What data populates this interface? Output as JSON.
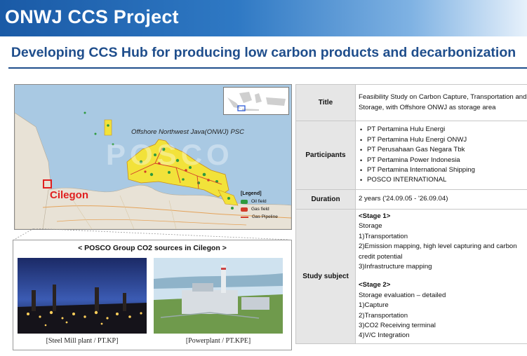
{
  "header": {
    "title": "ONWJ CCS Project",
    "subtitle": "Developing CCS Hub for producing low carbon products and decarbonization"
  },
  "map": {
    "psc_label": "Offshore Northwest Java(ONWJ) PSC",
    "city_label": "Cilegon",
    "watermark": "POSCO",
    "legend": {
      "title": "[Legend]",
      "items": [
        {
          "label": "Oil field",
          "color": "#2e9a3e"
        },
        {
          "label": "Gas field",
          "color": "#d23b2a"
        },
        {
          "label": "Gas Pipeline",
          "color": "#d23b2a"
        }
      ]
    },
    "colors": {
      "sea": "#a9c9e3",
      "land": "#e8e2d6",
      "block": "#f2e23a",
      "oil": "#2e9a3e",
      "pipeline": "#d23b2a"
    }
  },
  "sources": {
    "header": "< POSCO Group CO2 sources in Cilegon >",
    "captions": [
      "[Steel Mill plant / PT.KP]",
      "[Powerplant / PT.KPE]"
    ]
  },
  "table": {
    "title_key": "Title",
    "title_value": "Feasibility Study on Carbon Capture, Transportation and Storage, with Offshore ONWJ as storage area",
    "participants_key": "Participants",
    "participants": [
      "PT Pertamina Hulu Energi",
      "PT Pertamina Hulu Energi ONWJ",
      "PT Perusahaan Gas Negara Tbk",
      "PT Pertamina Power Indonesia",
      "PT Pertamina International Shipping",
      "POSCO INTERNATIONAL"
    ],
    "duration_key": "Duration",
    "duration_value": "2 years ('24.09.05 - '26.09.04)",
    "study_key": "Study subject",
    "stage1": {
      "title": "<Stage 1>",
      "lines": [
        "Storage",
        "1)Transportation",
        "2)Emission mapping, high level capturing and carbon credit potential",
        "3)Infrastructure mapping"
      ]
    },
    "stage2": {
      "title": "<Stage 2>",
      "lines": [
        "Storage evaluation – detailed",
        "1)Capture",
        "2)Transportation",
        "3)CO2 Receiving terminal",
        "4)V/C Integration"
      ]
    }
  }
}
